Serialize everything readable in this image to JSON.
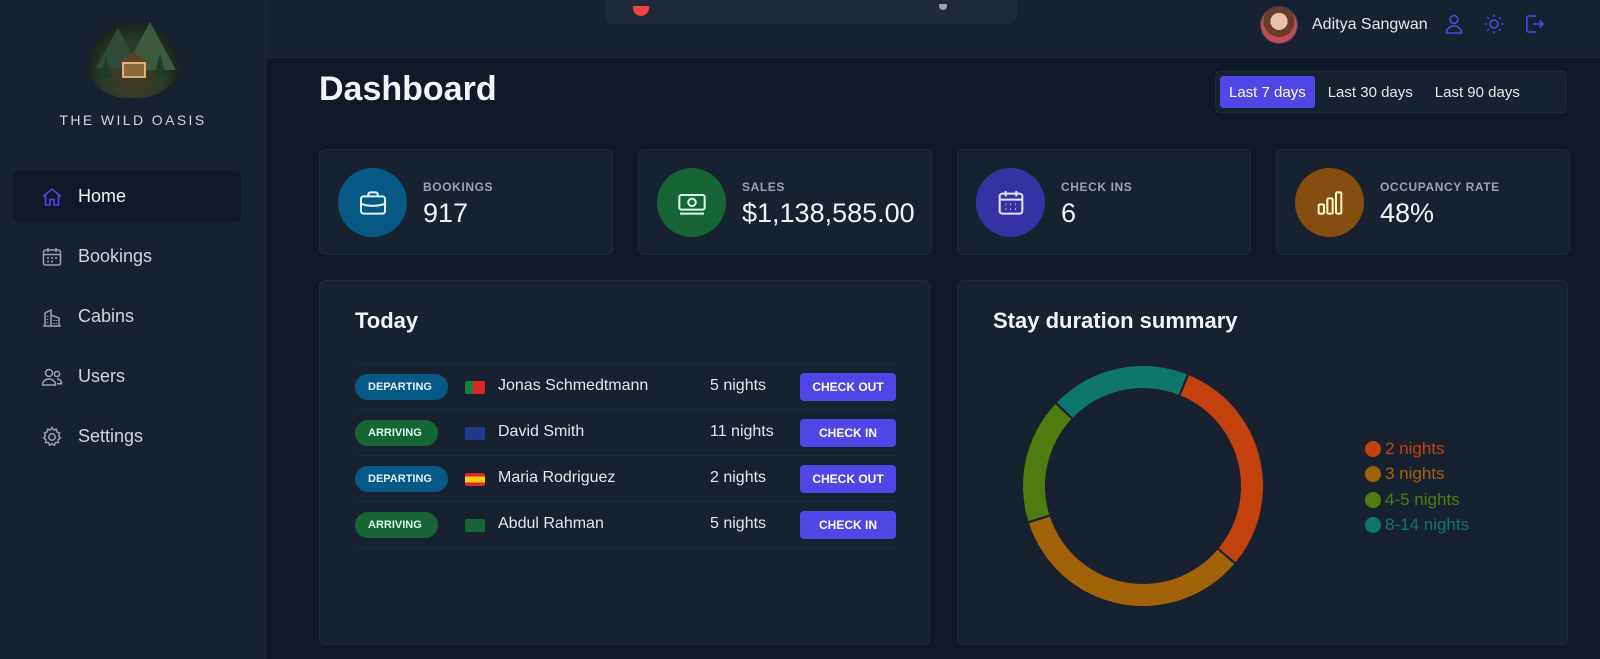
{
  "app": {
    "logo_text": "THE WILD OASIS"
  },
  "sidebar": {
    "items": [
      {
        "label": "Home",
        "icon": "home-icon",
        "active": true
      },
      {
        "label": "Bookings",
        "icon": "calendar-icon",
        "active": false
      },
      {
        "label": "Cabins",
        "icon": "building-icon",
        "active": false
      },
      {
        "label": "Users",
        "icon": "users-icon",
        "active": false
      },
      {
        "label": "Settings",
        "icon": "gear-icon",
        "active": false
      }
    ]
  },
  "header": {
    "user_name": "Aditya Sangwan",
    "icons": [
      "user-icon",
      "sun-icon",
      "logout-icon"
    ]
  },
  "main": {
    "title": "Dashboard",
    "filters": [
      {
        "label": "Last 7 days",
        "active": true
      },
      {
        "label": "Last 30 days",
        "active": false
      },
      {
        "label": "Last 90 days",
        "active": false
      }
    ]
  },
  "stats": [
    {
      "label": "BOOKINGS",
      "value": "917",
      "icon": "briefcase-icon",
      "color": "#075985",
      "icon_color": "#e0f2fe"
    },
    {
      "label": "SALES",
      "value": "$1,138,585.00",
      "icon": "banknotes-icon",
      "color": "#166534",
      "icon_color": "#dcfce7"
    },
    {
      "label": "CHECK INS",
      "value": "6",
      "icon": "calendar-days-icon",
      "color": "#3730a3",
      "icon_color": "#e0e7ff"
    },
    {
      "label": "OCCUPANCY RATE",
      "value": "48%",
      "icon": "chart-bar-icon",
      "color": "#854d0e",
      "icon_color": "#fef9c3"
    }
  ],
  "today": {
    "title": "Today",
    "rows": [
      {
        "status": "DEPARTING",
        "status_type": "dep",
        "flag": "portugal-flag",
        "guest": "Jonas Schmedtmann",
        "nights": "5 nights",
        "action": "CHECK OUT"
      },
      {
        "status": "ARRIVING",
        "status_type": "arr",
        "flag": "australia-flag",
        "guest": "David Smith",
        "nights": "11 nights",
        "action": "CHECK IN"
      },
      {
        "status": "DEPARTING",
        "status_type": "dep",
        "flag": "spain-flag",
        "guest": "Maria Rodriguez",
        "nights": "2 nights",
        "action": "CHECK OUT"
      },
      {
        "status": "ARRIVING",
        "status_type": "arr",
        "flag": "saudi-arabia-flag",
        "guest": "Abdul Rahman",
        "nights": "5 nights",
        "action": "CHECK IN"
      }
    ]
  },
  "stay_summary": {
    "title": "Stay duration summary"
  },
  "chart_data": {
    "type": "pie",
    "donut": true,
    "legend_position": "right",
    "categories": [
      "2 nights",
      "3 nights",
      "4-5 nights",
      "8-14 nights"
    ],
    "values": [
      30,
      34,
      17,
      19
    ],
    "colors": [
      "#c2410c",
      "#a16207",
      "#4d7c0f",
      "#0f766e"
    ],
    "start_angle_deg": 22
  }
}
